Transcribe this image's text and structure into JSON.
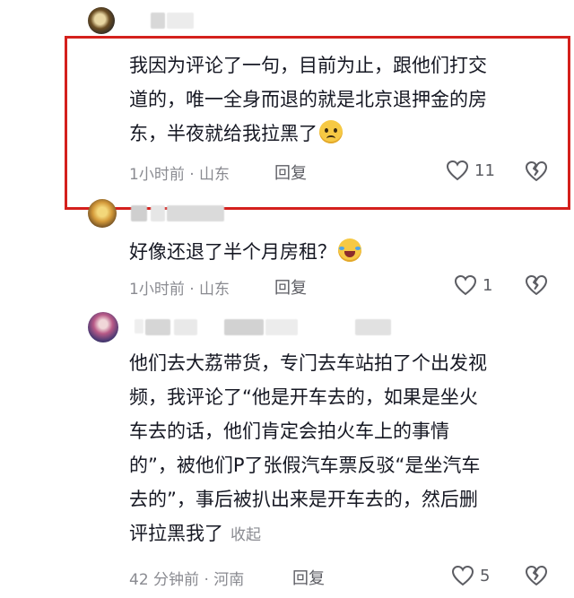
{
  "comments": [
    {
      "text": "我因为评论了一句，目前为止，跟他们打交\n道的，唯一全身而退的就是北京退押金的房\n东，半夜就给我拉黑了",
      "emoji": "worried-face",
      "meta": "1小时前 · 山东",
      "reply_label": "回复",
      "likes": "11",
      "highlighted": true,
      "highlight_color": "#d4201c"
    },
    {
      "text": "好像还退了半个月房租？",
      "emoji": "laughing-crying-face",
      "meta": "1小时前 · 山东",
      "reply_label": "回复",
      "likes": "1"
    },
    {
      "text": "他们去大荔带货，专门去车站拍了个出发视\n频，我评论了“他是开车去的，如果是坐火\n车去的话，他们肯定会拍火车上的事情\n的”，被他们P了张假汽车票反驳“是坐汽车\n去的”，事后被扒出来是开车去的，然后删\n评拉黑我了",
      "expand_label": "收起",
      "meta": "42 分钟前 · 河南",
      "reply_label": "回复",
      "likes": "5"
    }
  ],
  "colors": {
    "text": "#161823",
    "meta": "#8a8b91",
    "icon": "#5c5d63"
  }
}
